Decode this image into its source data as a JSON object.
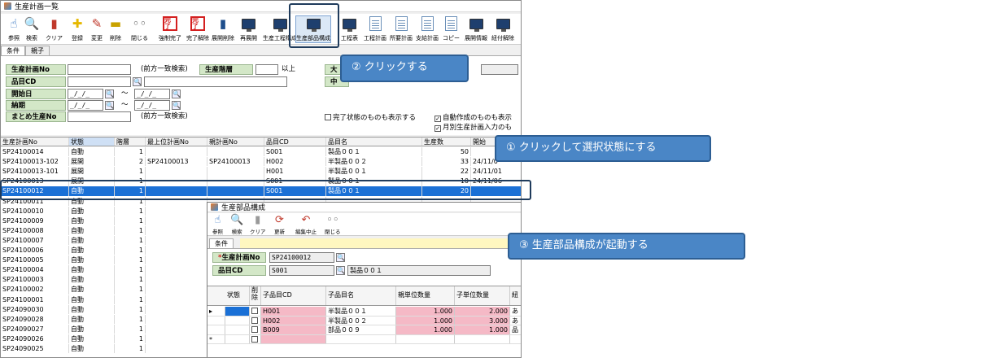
{
  "window": {
    "title": "生産計画一覧"
  },
  "toolbar": [
    {
      "name": "reference",
      "label": "参照",
      "icon": "☝"
    },
    {
      "name": "search",
      "label": "検索",
      "icon": "🔍"
    },
    {
      "name": "clear",
      "label": "クリア",
      "icon": "▮"
    },
    {
      "name": "register",
      "label": "登録",
      "icon": "✚"
    },
    {
      "name": "edit",
      "label": "変更",
      "icon": "✎"
    },
    {
      "name": "delete",
      "label": "削除",
      "icon": "▬"
    },
    {
      "name": "close",
      "label": "閉じる",
      "icon": "◦◦"
    },
    {
      "name": "force-complete",
      "label": "強制完了",
      "icon": "完了"
    },
    {
      "name": "cancel-complete",
      "label": "完了解除",
      "icon": "完了"
    },
    {
      "name": "expand-delete",
      "label": "展開削除",
      "icon": "▮"
    },
    {
      "name": "re-expand",
      "label": "再展開",
      "icon": "▣"
    },
    {
      "name": "production-process",
      "label": "生産工程構成",
      "icon": "▣"
    },
    {
      "name": "production-parts",
      "label": "生産部品構成",
      "icon": "▣"
    },
    {
      "name": "process-table",
      "label": "工程表",
      "icon": "▣"
    },
    {
      "name": "process-plan",
      "label": "工程計画",
      "icon": "▤"
    },
    {
      "name": "required-plan",
      "label": "所要計画",
      "icon": "▤"
    },
    {
      "name": "supply-plan",
      "label": "支給計画",
      "icon": "▤"
    },
    {
      "name": "copy",
      "label": "コピー",
      "icon": "▤"
    },
    {
      "name": "expand-info",
      "label": "展開情報",
      "icon": "▣"
    },
    {
      "name": "link-release",
      "label": "紐付解除",
      "icon": "▣"
    }
  ],
  "tabs": [
    "条件",
    "親子"
  ],
  "conditions": {
    "plan_no_label": "生産計画No",
    "prefix_match_1": "(前方一致検索)",
    "level_label": "生産階層",
    "or_more": "以上",
    "large_label": "大",
    "middle_label": "中",
    "item_cd_label": "品目CD",
    "start_date_label": "開始日",
    "due_label": "納期",
    "summary_no_label": "まとめ生産No",
    "prefix_match_2": "(前方一致検索)",
    "date_placeholder": "_/_/_",
    "tilde": "～",
    "show_completed": "完了状態のものも表示する",
    "show_auto_created": "自動作成のものも表示",
    "monthly_input": "月別生産計画入力のも"
  },
  "grid": {
    "columns": [
      "生産計画No",
      "状態",
      "階層",
      "最上位計画No",
      "親計画No",
      "品目CD",
      "品目名",
      "生産数",
      "開始"
    ],
    "rows": [
      [
        "SP24100014",
        "自動",
        "1",
        "",
        "",
        "S001",
        "製品００１",
        "50",
        ""
      ],
      [
        "SP24100013-102",
        "展開",
        "2",
        "SP24100013",
        "SP24100013",
        "H002",
        "半製品００２",
        "33",
        "24/11/0"
      ],
      [
        "SP24100013-101",
        "展開",
        "1",
        "",
        "",
        "H001",
        "半製品００１",
        "22",
        "24/11/01"
      ],
      [
        "SP24100013",
        "展開",
        "1",
        "",
        "",
        "S001",
        "製品００１",
        "10",
        "24/11/06"
      ],
      [
        "SP24100012",
        "自動",
        "1",
        "",
        "",
        "S001",
        "製品００１",
        "20",
        ""
      ],
      [
        "SP24100011",
        "自動",
        "1",
        "",
        "",
        "",
        "",
        "",
        ""
      ],
      [
        "SP24100010",
        "自動",
        "1",
        "",
        "",
        "",
        "",
        "",
        ""
      ],
      [
        "SP24100009",
        "自動",
        "1",
        "",
        "",
        "",
        "",
        "",
        ""
      ],
      [
        "SP24100008",
        "自動",
        "1",
        "",
        "",
        "",
        "",
        "",
        ""
      ],
      [
        "SP24100007",
        "自動",
        "1",
        "",
        "",
        "",
        "",
        "",
        ""
      ],
      [
        "SP24100006",
        "自動",
        "1",
        "",
        "",
        "",
        "",
        "",
        ""
      ],
      [
        "SP24100005",
        "自動",
        "1",
        "",
        "",
        "",
        "",
        "",
        ""
      ],
      [
        "SP24100004",
        "自動",
        "1",
        "",
        "",
        "",
        "",
        "",
        ""
      ],
      [
        "SP24100003",
        "自動",
        "1",
        "",
        "",
        "",
        "",
        "",
        ""
      ],
      [
        "SP24100002",
        "自動",
        "1",
        "",
        "",
        "",
        "",
        "",
        ""
      ],
      [
        "SP24100001",
        "自動",
        "1",
        "",
        "",
        "",
        "",
        "",
        ""
      ],
      [
        "SP24090030",
        "自動",
        "1",
        "",
        "",
        "",
        "",
        "",
        ""
      ],
      [
        "SP24090028",
        "自動",
        "1",
        "",
        "",
        "",
        "",
        "",
        ""
      ],
      [
        "SP24090027",
        "自動",
        "1",
        "",
        "",
        "",
        "",
        "",
        ""
      ],
      [
        "SP24090026",
        "自動",
        "1",
        "",
        "",
        "",
        "",
        "",
        ""
      ],
      [
        "SP24090025",
        "自動",
        "1",
        "",
        "",
        "",
        "",
        "",
        ""
      ]
    ]
  },
  "subwindow": {
    "title": "生産部品構成",
    "toolbar": [
      {
        "label": "参照",
        "icon": "☝"
      },
      {
        "label": "検索",
        "icon": "🔍"
      },
      {
        "label": "クリア",
        "icon": "▮"
      },
      {
        "label": "更新",
        "icon": "⟳"
      },
      {
        "label": "編集中止",
        "icon": "↶"
      },
      {
        "label": "閉じる",
        "icon": "◦◦"
      }
    ],
    "tab": "条件",
    "plan_no_label": "生産計画No",
    "plan_no_value": "SP24100012",
    "item_cd_label": "品目CD",
    "item_cd_value": "S001",
    "item_name_value": "製品００１",
    "columns": [
      "状態",
      "削除",
      "子品目CD",
      "子品目名",
      "親単位数量",
      "子単位数量",
      "紐"
    ],
    "rows": [
      {
        "marker": "▸",
        "code": "H001",
        "name": "半製品００１",
        "parent_qty": "1.000",
        "child_qty": "2.000",
        "extra": "あ"
      },
      {
        "marker": "",
        "code": "H002",
        "name": "半製品００２",
        "parent_qty": "1.000",
        "child_qty": "3.000",
        "extra": "あ"
      },
      {
        "marker": "",
        "code": "B009",
        "name": "部品００９",
        "parent_qty": "1.000",
        "child_qty": "1.000",
        "extra": "品"
      },
      {
        "marker": "*",
        "code": "",
        "name": "",
        "parent_qty": "",
        "child_qty": "",
        "extra": ""
      }
    ]
  },
  "callouts": {
    "step1": "① クリックして選択状態にする",
    "step2": "② クリックする",
    "step3": "③ 生産部品構成が起動する"
  }
}
